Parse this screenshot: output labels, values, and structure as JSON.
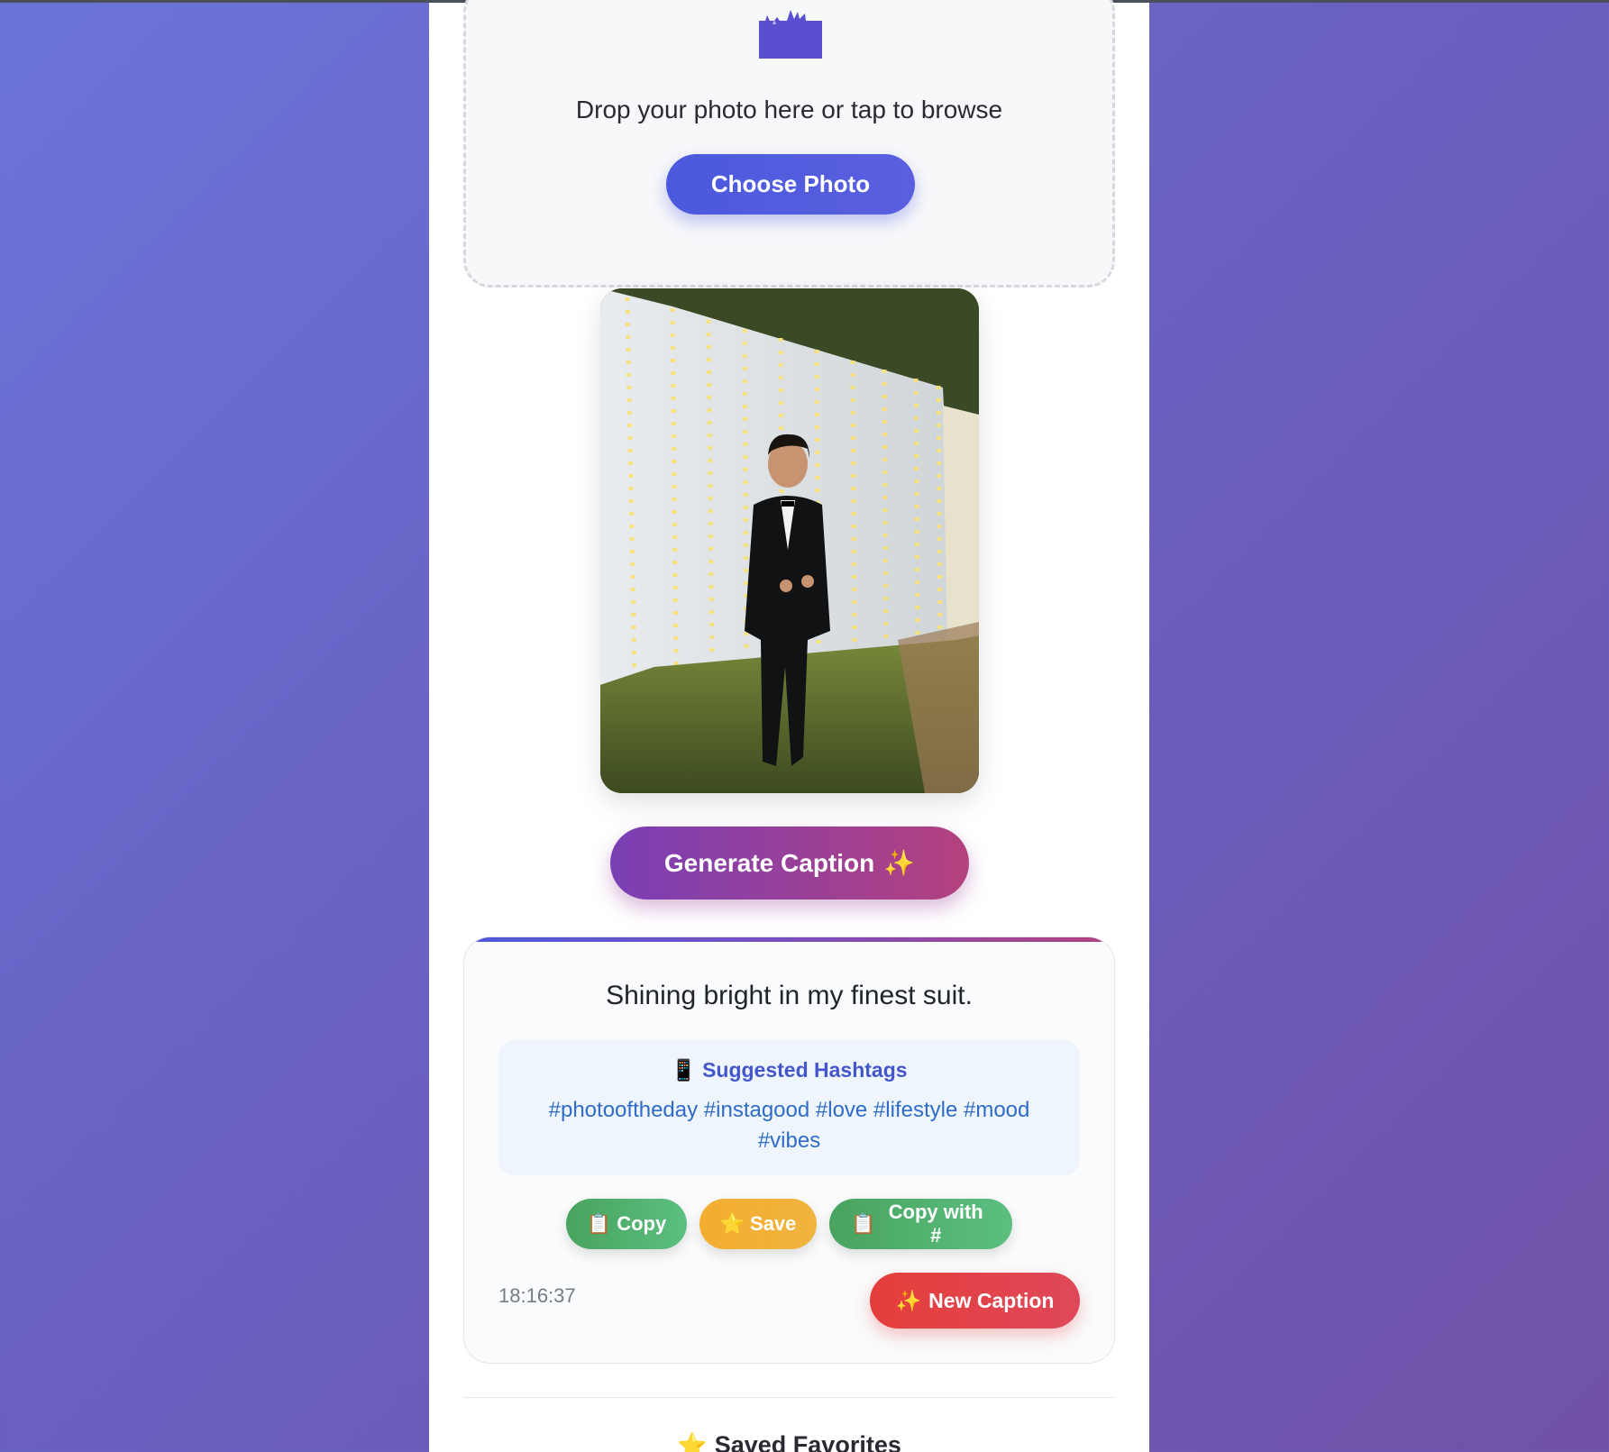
{
  "upload": {
    "icon": "upload-clapper-icon",
    "prompt": "Drop your photo here or tap to browse",
    "choose_label": "Choose Photo"
  },
  "photo": {
    "alt": "uploaded-photo"
  },
  "generate": {
    "label": "Generate Caption",
    "icon": "✨"
  },
  "result": {
    "caption": "Shining bright in my finest suit.",
    "hashtags_icon": "📱",
    "hashtags_title": "Suggested Hashtags",
    "hashtags": "#photooftheday #instagood #love #lifestyle #mood #vibes",
    "copy_icon": "📋",
    "copy_label": "Copy",
    "save_icon": "⭐",
    "save_label": "Save",
    "copy_hash_icon": "📋",
    "copy_hash_label": "Copy with #",
    "timestamp": "18:16:37",
    "new_icon": "✨",
    "new_label": "New Caption"
  },
  "saved": {
    "icon": "⭐",
    "title": "Saved Favorites"
  },
  "colors": {
    "primary": "#4b59dc",
    "generate_start": "#7a3fb5",
    "generate_end": "#b4417e",
    "copy_green": "#48a35e",
    "save_orange": "#f3ad2f",
    "new_red": "#e43e3a",
    "hashtag_blue": "#2f6cc9"
  }
}
